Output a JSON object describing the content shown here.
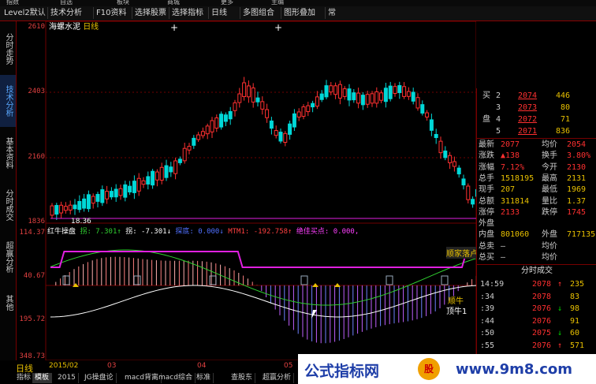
{
  "topbar": {
    "items": [
      "指数",
      "自选",
      "板块",
      "商城",
      "更多",
      "主编"
    ]
  },
  "menubar": {
    "items": [
      "Level2默认",
      "技术分析",
      "F10资料",
      "选择股票",
      "选择指标",
      "日线",
      "多图组合",
      "图形叠加",
      "常"
    ]
  },
  "left_tabs": [
    "分时走势",
    "技术分析",
    "基本资料",
    "分时成交",
    "超赢分析",
    "其他"
  ],
  "left_tab_active": 1,
  "chart_title": {
    "stock": "海螺水泥",
    "period": "日线"
  },
  "price_axis": [
    "2610",
    "2403",
    "2160",
    "1836"
  ],
  "price_low_label": "18.36",
  "indicator_axis": [
    "114.37",
    "40.67",
    "195.72",
    "348.73"
  ],
  "indicator_title": {
    "name": "红牛操盘",
    "parts": [
      "拐: 7.301↑",
      "拐: -7.301↓",
      "探底: 0.000↓",
      "MTM1: -192.758↑",
      "绝佳买点: 0.000,"
    ]
  },
  "overlay_labels": {
    "sell": "顺家落卢",
    "buy": "顺牛",
    "buy2": "顶牛1"
  },
  "quote_panel": {
    "book": [
      {
        "side": "买",
        "level": "2",
        "price": "2074",
        "volume": "446"
      },
      {
        "side": "",
        "level": "3",
        "price": "2073",
        "volume": "80"
      },
      {
        "side": "盘",
        "level": "4",
        "price": "2072",
        "volume": "71"
      },
      {
        "side": "",
        "level": "5",
        "price": "2071",
        "volume": "836"
      }
    ],
    "stats": [
      [
        "最新",
        "2077",
        "均价",
        "2054"
      ],
      [
        "涨跌",
        "▲138",
        "换手",
        "3.80%"
      ],
      [
        "涨幅",
        "7.12%",
        "今开",
        "2130"
      ],
      [
        "总手",
        "1518195",
        "最高",
        "2131"
      ],
      [
        "现手",
        "207",
        "最低",
        "1969"
      ],
      [
        "总额",
        "311814",
        "量比",
        "1.37"
      ],
      [
        "涨停",
        "2133",
        "跌停",
        "1745"
      ],
      [
        "外盘",
        "",
        "",
        ""
      ],
      [
        "内盘",
        "801060",
        "外盘",
        "717135"
      ],
      [
        "总卖",
        "—",
        "均价",
        ""
      ],
      [
        "总买",
        "—",
        "均价",
        ""
      ]
    ],
    "ticks_header": "分时成交",
    "ticks": [
      {
        "time": "14:59",
        "price": "2078",
        "dir": "↑",
        "vol": "235"
      },
      {
        "time": ":34",
        "price": "2078",
        "dir": "",
        "vol": "83"
      },
      {
        "time": ":39",
        "price": "2076",
        "dir": "↓",
        "vol": "98"
      },
      {
        "time": ":44",
        "price": "2076",
        "dir": "",
        "vol": "91"
      },
      {
        "time": ":50",
        "price": "2075",
        "dir": "↓",
        "vol": "60"
      },
      {
        "time": ":55",
        "price": "2076",
        "dir": "↑",
        "vol": "571"
      }
    ]
  },
  "x_axis": [
    "日线",
    "2015/02",
    "03",
    "04",
    "05"
  ],
  "bottom_tabs": [
    "指标",
    "模板",
    "2015",
    "JG操盘论",
    "macd背离",
    "macd综合",
    "标准",
    "查股东",
    "超赢分析"
  ],
  "banner": {
    "left": "公式指标网",
    "logo": "股",
    "right": "www.9m8.com"
  },
  "colors": {
    "up": "#ff3030",
    "down": "#00d8d8",
    "axis": "#e04040",
    "grid": "#700000",
    "yellow": "#e8c000",
    "magenta": "#e020e0"
  }
}
